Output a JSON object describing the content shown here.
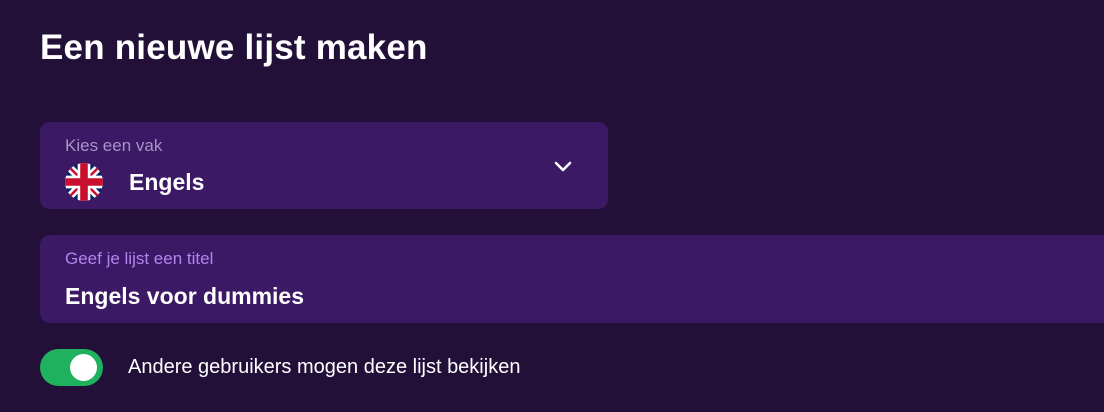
{
  "page": {
    "title": "Een nieuwe lijst maken"
  },
  "subject_select": {
    "label": "Kies een vak",
    "selected": "Engels",
    "flag_icon": "uk-flag-icon",
    "expand_icon": "chevron-down-icon"
  },
  "title_field": {
    "label": "Geef je lijst een titel",
    "value": "Engels voor dummies"
  },
  "visibility_toggle": {
    "label": "Andere gebruikers mogen deze lijst bekijken",
    "checked": true
  },
  "colors": {
    "background": "#221039",
    "field_background": "#3c1965",
    "field_label_muted": "#a893c6",
    "field_label_accent": "#b384f0",
    "toggle_on": "#20b15f"
  }
}
